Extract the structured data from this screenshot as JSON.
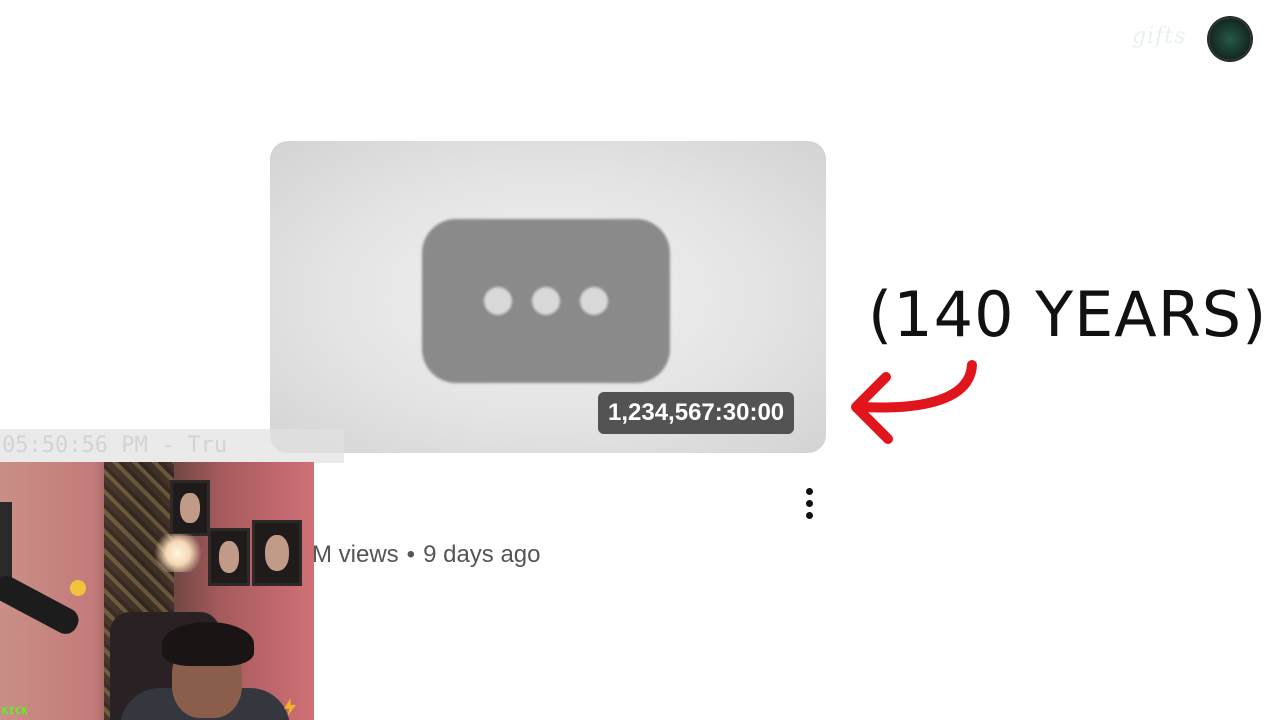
{
  "overlay": {
    "brand_text": "gifts",
    "brand_logo_icon": "streamer-logo-icon"
  },
  "video": {
    "duration": "1,234,567:30:00",
    "placeholder_icon": "video-placeholder-icon",
    "meta_views": "M views",
    "meta_separator": "•",
    "meta_age": "9 days ago",
    "menu_icon": "more-vert-icon"
  },
  "annotation": {
    "text": "(140 YEARS)",
    "arrow_icon": "red-arrow-icon",
    "arrow_color": "#e0161c"
  },
  "stream": {
    "clock_text": "05:50:56 PM - Tru",
    "platform_badge": "KICK",
    "platform_color": "#53fc18"
  }
}
